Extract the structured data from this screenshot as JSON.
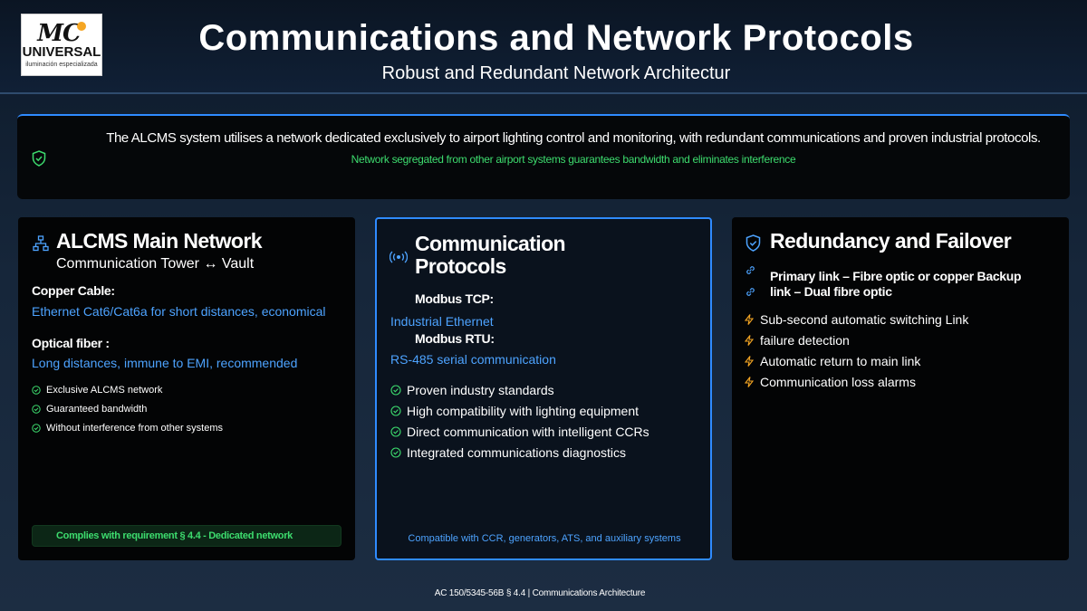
{
  "logo": {
    "mark": "MC",
    "name": "UNIVERSAL",
    "tagline": "iluminación especializada"
  },
  "header": {
    "title": "Communications and Network Protocols",
    "subtitle": "Robust and Redundant Network Architectur"
  },
  "banner": {
    "icon": "shield-check-icon",
    "text": "The ALCMS system utilises a network dedicated exclusively to airport lighting control and monitoring, with redundant communications and proven industrial protocols.",
    "subtext": "Network segregated from other airport systems guarantees bandwidth and eliminates interference"
  },
  "cards": {
    "network": {
      "icon": "network-icon",
      "title": "ALCMS Main Network",
      "subtitle": "Communication Tower ↔ Vault",
      "copper_label": "Copper Cable:",
      "copper_text": "Ethernet Cat6/Cat6a for short distances, economical",
      "fiber_label": "Optical fiber :",
      "fiber_text": "Long distances, immune to EMI, recommended",
      "checks": [
        "Exclusive ALCMS network",
        "Guaranteed bandwidth",
        "Without interference from other systems"
      ],
      "compliance": "Complies with requirement § 4.4 - Dedicated network"
    },
    "protocols": {
      "icon": "broadcast-icon",
      "title_line1": "Communication",
      "title_line2": "Protocols",
      "modbus_tcp_label": "Modbus TCP:",
      "modbus_tcp_text": "Industrial Ethernet",
      "modbus_rtu_label": "Modbus RTU:",
      "modbus_rtu_text": "RS-485 serial communication",
      "checks": [
        "Proven industry standards",
        "High compatibility with lighting equipment",
        "Direct communication with intelligent CCRs",
        "Integrated communications diagnostics"
      ],
      "compat": "Compatible with CCR, generators, ATS, and auxiliary systems"
    },
    "redundancy": {
      "icon": "shield-icon",
      "title": "Redundancy and Failover",
      "link_line1": "Primary link – Fibre optic or copper Backup",
      "link_line2": "link – Dual fibre optic",
      "bolts": [
        "Sub-second automatic switching Link",
        "failure detection",
        "Automatic return to main link",
        "Communication loss alarms"
      ]
    }
  },
  "footer": "AC 150/5345-56B § 4.4 | Communications Architecture",
  "colors": {
    "accent_blue": "#2f8bff",
    "text_blue": "#4da3ff",
    "green": "#3ddc6e",
    "orange": "#f5a623"
  }
}
